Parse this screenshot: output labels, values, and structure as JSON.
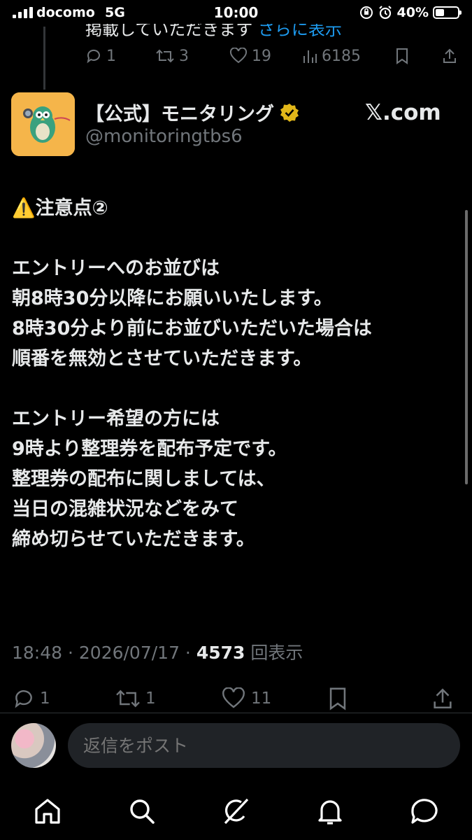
{
  "status_bar": {
    "carrier": "docomo",
    "network": "5G",
    "time": "10:00",
    "battery": "40%",
    "battery_level": 0.4
  },
  "previous_tweet": {
    "text_fragment": "掲載していただきます",
    "show_more": "さらに表示",
    "replies": "1",
    "retweets": "3",
    "likes": "19",
    "views": "6185"
  },
  "tweet": {
    "display_name": "【公式】モニタリング",
    "handle": "@monitoringtbs6",
    "source_watermark": "𝕏.com",
    "body": "⚠️注意点②\n\nエントリーへのお並びは\n朝8時30分以降にお願いいたします。\n8時30分より前にお並びいただいた場合は\n順番を無効とさせていただきます。\n\nエントリー希望の方には\n9時より整理券を配布予定です。\n整理券の配布に関しましては、\n当日の混雑状況などをみて\n締め切らせていただきます。",
    "time": "18:48",
    "date": "2026/07/17",
    "views_count": "4573",
    "views_label": "回表示",
    "replies": "1",
    "retweets": "1",
    "likes": "11"
  },
  "reply_box": {
    "placeholder": "返信をポスト"
  },
  "tab_bar": {
    "icons": [
      "home-icon",
      "search-icon",
      "grok-icon",
      "notifications-icon",
      "messages-icon"
    ]
  },
  "colors": {
    "background": "#000000",
    "text": "#e7e9ea",
    "secondary": "#71767b",
    "link": "#1d9bf0",
    "verified": "#e2b719"
  }
}
